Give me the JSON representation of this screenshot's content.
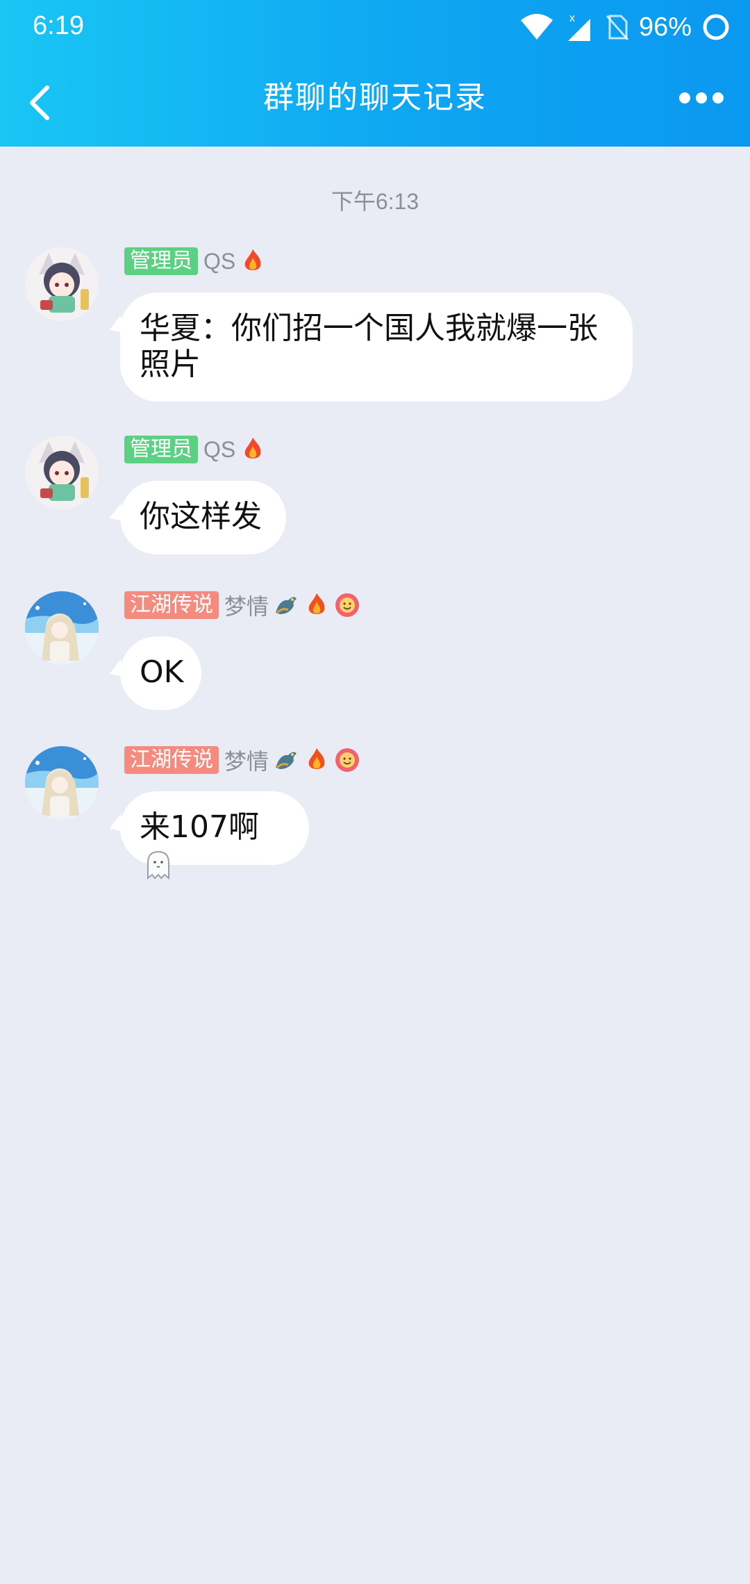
{
  "status_bar": {
    "time": "6:19",
    "battery_percent": "96%"
  },
  "header": {
    "title": "群聊的聊天记录"
  },
  "chat": {
    "timestamp": "下午6:13",
    "messages": [
      {
        "badge": "管理员",
        "badge_color": "#5dd183",
        "nickname": "QS",
        "text": "华夏：你们招一个国人我就爆一张照片"
      },
      {
        "badge": "管理员",
        "badge_color": "#5dd183",
        "nickname": "QS",
        "text": "你这样发"
      },
      {
        "badge": "江湖传说",
        "badge_color": "#f48b7e",
        "nickname": "梦情",
        "text": "OK"
      },
      {
        "badge": "江湖传说",
        "badge_color": "#f48b7e",
        "nickname": "梦情",
        "text": "来107啊"
      }
    ]
  },
  "colors": {
    "header_start": "#19c6f4",
    "header_end": "#0b98f0",
    "background": "#e9ecf5"
  }
}
